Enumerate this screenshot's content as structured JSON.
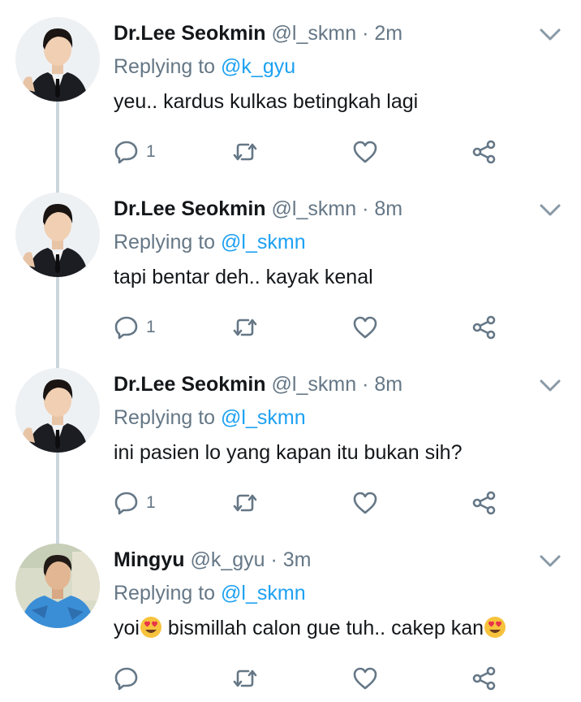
{
  "tweets": [
    {
      "name": "Dr.Lee Seokmin",
      "handle": "@l_skmn",
      "dot": "·",
      "time": "2m",
      "replying_prefix": "Replying to",
      "replying_mention": "@k_gyu",
      "text": "yeu.. kardus kulkas betingkah lagi",
      "reply_count": "1",
      "avatar": "suit-person-avatar"
    },
    {
      "name": "Dr.Lee Seokmin",
      "handle": "@l_skmn",
      "dot": "·",
      "time": "8m",
      "replying_prefix": "Replying to",
      "replying_mention": "@l_skmn",
      "text": "tapi bentar deh.. kayak kenal",
      "reply_count": "1",
      "avatar": "suit-person-avatar"
    },
    {
      "name": "Dr.Lee Seokmin",
      "handle": "@l_skmn",
      "dot": "·",
      "time": "8m",
      "replying_prefix": "Replying to",
      "replying_mention": "@l_skmn",
      "text": "ini pasien lo yang kapan itu bukan sih?",
      "reply_count": "1",
      "avatar": "suit-person-avatar"
    },
    {
      "name": "Mingyu",
      "handle": "@k_gyu",
      "dot": "·",
      "time": "3m",
      "replying_prefix": "Replying to",
      "replying_mention": "@l_skmn",
      "text_part1": "yoi",
      "text_part2": " bismillah calon gue tuh.. cakep kan",
      "emoji": "heart-eyes-emoji",
      "reply_count": "",
      "avatar": "blue-shirt-person-avatar"
    }
  ],
  "colors": {
    "text": "#14171a",
    "secondary": "#657786",
    "mention": "#1da1f2",
    "thread_line": "#ccd6dd"
  },
  "icons": [
    "reply-icon",
    "retweet-icon",
    "like-icon",
    "share-icon",
    "chevron-down-icon"
  ]
}
